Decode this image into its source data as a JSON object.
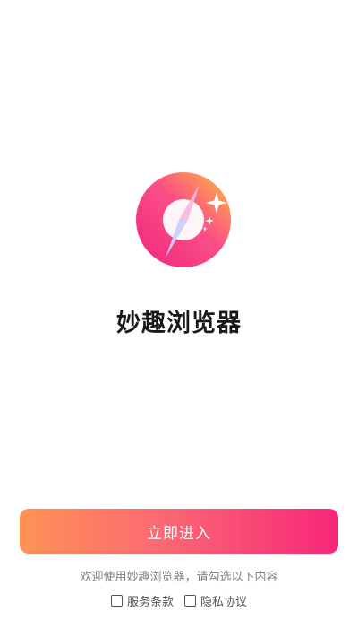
{
  "app": {
    "name": "妙趣浏览器",
    "logo_icon": "compass-icon",
    "brand_gradient": [
      "#ffb341",
      "#ff5e8a",
      "#f52c7a"
    ]
  },
  "enter_button": {
    "label": "立即进入",
    "gradient": [
      "#ff9255",
      "#f72679"
    ]
  },
  "consent": {
    "prompt": "欢迎使用妙趣浏览器，请勾选以下内容",
    "items": [
      {
        "label": "服务条款",
        "checked": false
      },
      {
        "label": "隐私协议",
        "checked": false
      }
    ]
  }
}
